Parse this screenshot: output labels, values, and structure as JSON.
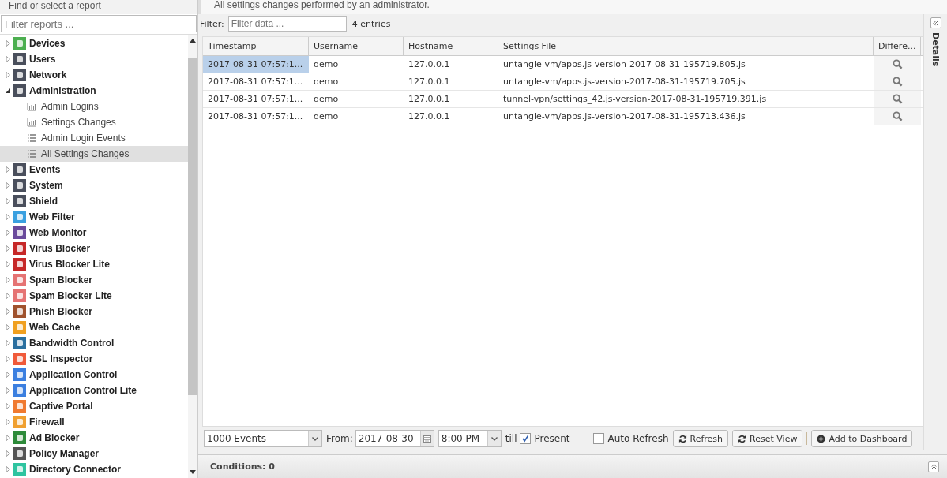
{
  "sidebar": {
    "heading": "Find or select a report",
    "filter": {
      "placeholder": "Filter reports ..."
    },
    "items": [
      {
        "label": "Devices",
        "expanded": false,
        "selected": false,
        "color": "#4caf50"
      },
      {
        "label": "Users",
        "expanded": false,
        "selected": false,
        "color": "#4a4f5c"
      },
      {
        "label": "Network",
        "expanded": false,
        "selected": false,
        "color": "#4a4f5c"
      },
      {
        "label": "Administration",
        "expanded": true,
        "selected": false,
        "color": "#4a4f5c",
        "children": [
          {
            "label": "Admin Logins",
            "kind": "chart",
            "selected": false
          },
          {
            "label": "Settings Changes",
            "kind": "chart",
            "selected": false
          },
          {
            "label": "Admin Login Events",
            "kind": "list",
            "selected": false
          },
          {
            "label": "All Settings Changes",
            "kind": "list",
            "selected": true
          }
        ]
      },
      {
        "label": "Events",
        "expanded": false,
        "selected": false,
        "color": "#4a4f5c"
      },
      {
        "label": "System",
        "expanded": false,
        "selected": false,
        "color": "#4a4f5c"
      },
      {
        "label": "Shield",
        "expanded": false,
        "selected": false,
        "color": "#4a4f5c"
      },
      {
        "label": "Web Filter",
        "expanded": false,
        "selected": false,
        "color": "#3aa0e0"
      },
      {
        "label": "Web Monitor",
        "expanded": false,
        "selected": false,
        "color": "#6a4a9c"
      },
      {
        "label": "Virus Blocker",
        "expanded": false,
        "selected": false,
        "color": "#c62828"
      },
      {
        "label": "Virus Blocker Lite",
        "expanded": false,
        "selected": false,
        "color": "#c62828"
      },
      {
        "label": "Spam Blocker",
        "expanded": false,
        "selected": false,
        "color": "#e57373"
      },
      {
        "label": "Spam Blocker Lite",
        "expanded": false,
        "selected": false,
        "color": "#e57373"
      },
      {
        "label": "Phish Blocker",
        "expanded": false,
        "selected": false,
        "color": "#a0522d"
      },
      {
        "label": "Web Cache",
        "expanded": false,
        "selected": false,
        "color": "#f0a020"
      },
      {
        "label": "Bandwidth Control",
        "expanded": false,
        "selected": false,
        "color": "#2a6f9f"
      },
      {
        "label": "SSL Inspector",
        "expanded": false,
        "selected": false,
        "color": "#f05a3a"
      },
      {
        "label": "Application Control",
        "expanded": false,
        "selected": false,
        "color": "#3b7fe0"
      },
      {
        "label": "Application Control Lite",
        "expanded": false,
        "selected": false,
        "color": "#3b7fe0"
      },
      {
        "label": "Captive Portal",
        "expanded": false,
        "selected": false,
        "color": "#f07a30"
      },
      {
        "label": "Firewall",
        "expanded": false,
        "selected": false,
        "color": "#f0a030"
      },
      {
        "label": "Ad Blocker",
        "expanded": false,
        "selected": false,
        "color": "#2e8b3a"
      },
      {
        "label": "Policy Manager",
        "expanded": false,
        "selected": false,
        "color": "#555555"
      },
      {
        "label": "Directory Connector",
        "expanded": false,
        "selected": false,
        "color": "#2ec4a0"
      }
    ]
  },
  "report": {
    "description": "All settings changes performed by an administrator.",
    "filter": {
      "label": "Filter:",
      "placeholder": "Filter data ...",
      "count": "4 entries"
    },
    "table": {
      "columns": [
        "Timestamp",
        "Username",
        "Hostname",
        "Settings File",
        "Differe..."
      ],
      "rows": [
        {
          "selected": true,
          "cells": [
            "2017-08-31 07:57:1...",
            "demo",
            "127.0.0.1",
            "untangle-vm/apps.js-version-2017-08-31-195719.805.js"
          ]
        },
        {
          "selected": false,
          "cells": [
            "2017-08-31 07:57:1...",
            "demo",
            "127.0.0.1",
            "untangle-vm/apps.js-version-2017-08-31-195719.705.js"
          ]
        },
        {
          "selected": false,
          "cells": [
            "2017-08-31 07:57:1...",
            "demo",
            "127.0.0.1",
            "tunnel-vpn/settings_42.js-version-2017-08-31-195719.391.js"
          ]
        },
        {
          "selected": false,
          "cells": [
            "2017-08-31 07:57:1...",
            "demo",
            "127.0.0.1",
            "untangle-vm/apps.js-version-2017-08-31-195713.436.js"
          ]
        }
      ]
    },
    "toolbar": {
      "limit": "1000 Events",
      "from_label": "From:",
      "date": "2017-08-30",
      "time": "8:00 PM",
      "till_label": "till",
      "present": {
        "label": "Present",
        "checked": true
      },
      "auto_refresh": {
        "label": "Auto Refresh",
        "checked": false
      },
      "buttons": [
        "Refresh",
        "Reset View",
        "Add to Dashboard"
      ]
    },
    "conditions": "Conditions: 0"
  },
  "details_panel": {
    "title": "Details"
  }
}
